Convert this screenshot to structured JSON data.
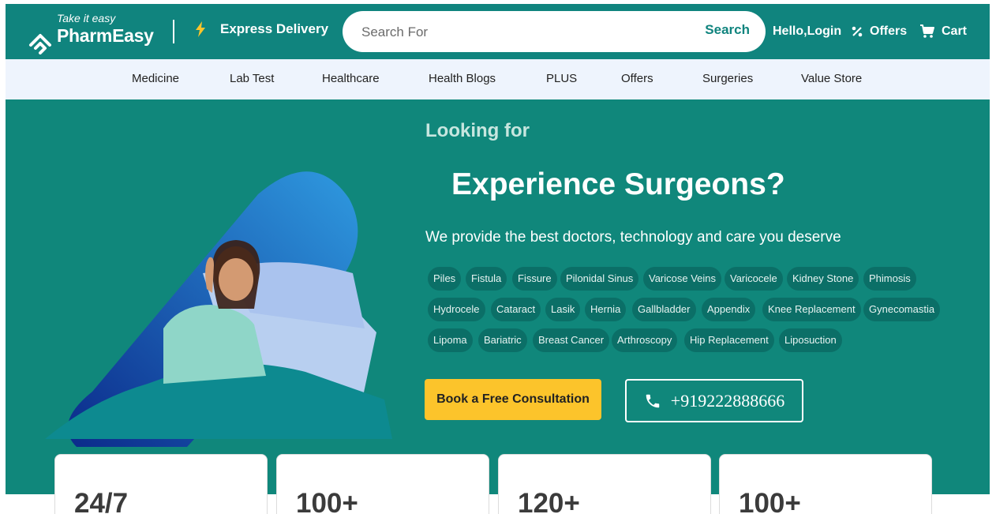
{
  "header": {
    "logo_tagline": "Take it easy",
    "logo_name": "PharmEasy",
    "express_label": "Express Delivery",
    "search_placeholder": "Search For",
    "search_button": "Search",
    "login_label": "Hello,Login",
    "offers_label": "Offers",
    "cart_label": "Cart"
  },
  "nav": {
    "items": [
      "Medicine",
      "Lab Test",
      "Healthcare",
      "Health Blogs",
      "PLUS",
      "Offers",
      "Surgeries",
      "Value Store"
    ]
  },
  "hero": {
    "eyebrow": "Looking for",
    "headline": "Experience Surgeons?",
    "subtext": "We provide the best doctors, technology and care you deserve",
    "chips": [
      "Piles",
      "Fistula",
      "Fissure",
      "Pilonidal Sinus",
      "Varicose Veins",
      "Varicocele",
      "Kidney Stone",
      "Phimosis",
      "Hydrocele",
      "Cataract",
      "Lasik",
      "Hernia",
      "Gallbladder",
      "Appendix",
      "Knee Replacement",
      "Gynecomastia",
      "Lipoma",
      "Bariatric",
      "Breast Cancer",
      "Arthroscopy",
      "Hip Replacement",
      "Liposuction"
    ],
    "cta_label": "Book a Free Consultation",
    "phone_number": "+919222888666"
  },
  "stats": [
    "24/7",
    "100+",
    "120+",
    "100+"
  ],
  "colors": {
    "brand_teal": "#10847e",
    "hero_teal": "#10877b",
    "cta_yellow": "#fcc42b",
    "nav_bg": "#eef4fd"
  },
  "icons": [
    "pharmeasy-logo-icon",
    "lightning-icon",
    "percent-icon",
    "cart-icon",
    "phone-icon"
  ]
}
